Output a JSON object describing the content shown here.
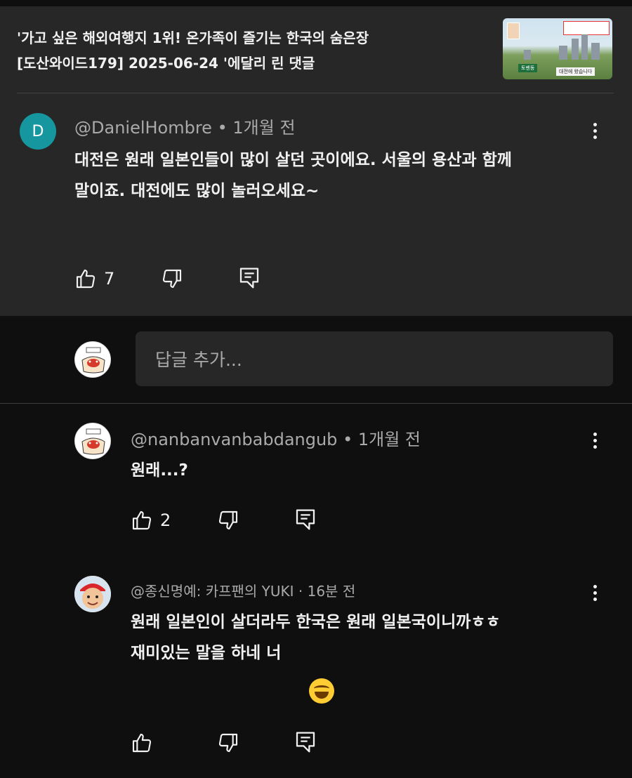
{
  "video": {
    "title_line1": "'가고 싶은 해외여행지 1위! 온가족이 즐기는 한국의 숨은장",
    "title_line2": "[도산와이드179] 2025-06-24 '에달리 린 댓글",
    "thumb_caption1": "토벤동",
    "thumb_caption2": "대전에 왔습니다"
  },
  "comment": {
    "avatar_letter": "D",
    "author": "@DanielHombre",
    "sep": "•",
    "time": "1개월 전",
    "text_line1": "대전은 원래 일본인들이 많이 살던 곳이에요. 서울의 용산과 함께",
    "text_line2": "말이죠. 대전에도 많이 놀러오세요~",
    "likes": "7"
  },
  "reply_input": {
    "placeholder": "답글 추가..."
  },
  "replies": [
    {
      "author": "@nanbanvanbabdangub",
      "sep": "•",
      "time": "1개월 전",
      "text_line1": "원래...?",
      "likes": "2"
    },
    {
      "author": "@종신명예: 카프팬의 YUKI",
      "sep": "·",
      "time": "16분 전",
      "text_line1": "원래 일본인이 살더라두 한국은 원래 일본국이니까ㅎㅎ",
      "text_line2": "재미있는 말을 하네 너"
    }
  ],
  "colors": {
    "background": "#0f0f0f",
    "card": "#272727",
    "secondary_text": "#aaaaaa",
    "avatar_d": "#16979f"
  },
  "icons": [
    "like-icon",
    "dislike-icon",
    "reply-icon",
    "more-vert-icon",
    "grinning-sweat-emoji"
  ]
}
